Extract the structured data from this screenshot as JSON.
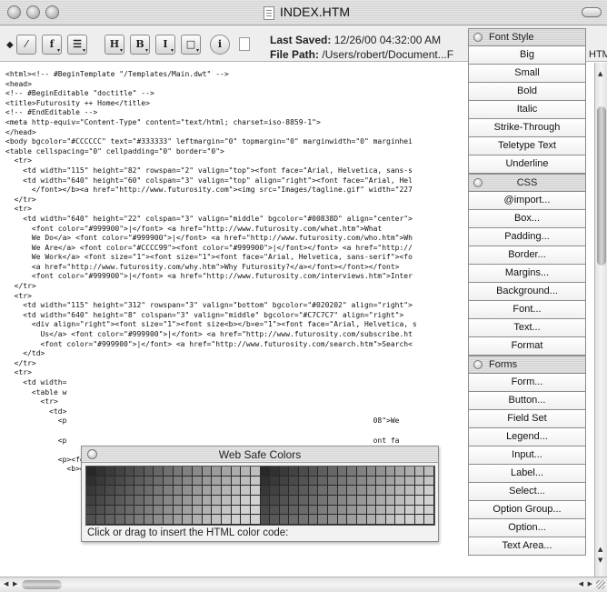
{
  "window": {
    "title": "INDEX.HTM"
  },
  "toolbar": {
    "buttons": [
      {
        "glyph": "⁄"
      },
      {
        "glyph": "f"
      },
      {
        "glyph": "☰"
      },
      {
        "glyph": "H"
      },
      {
        "glyph": "B"
      },
      {
        "glyph": "I"
      },
      {
        "glyph": "□"
      },
      {
        "glyph": "i"
      }
    ],
    "last_saved_label": "Last Saved:",
    "last_saved_value": "12/26/00 04:32:00 AM",
    "file_path_label": "File Path:",
    "file_path_value": "/Users/robert/Document...F",
    "right_text": "HTM"
  },
  "code_lines": [
    "<html><!-- #BeginTemplate \"/Templates/Main.dwt\" -->",
    "<head>",
    "<!-- #BeginEditable \"doctitle\" -->",
    "<title>Futurosity ++ Home</title>",
    "<!-- #EndEditable -->",
    "<meta http-equiv=\"Content-Type\" content=\"text/html; charset=iso-8859-1\">",
    "</head>",
    "<body bgcolor=\"#CCCCCC\" text=\"#333333\" leftmargin=\"0\" topmargin=\"0\" marginwidth=\"0\" marginhei",
    "<table cellspacing=\"0\" cellpadding=\"0\" border=\"0\">",
    "  <tr>",
    "    <td width=\"115\" height=\"82\" rowspan=\"2\" valign=\"top\"><font face=\"Arial, Helvetica, sans-s",
    "    <td width=\"640\" height=\"60\" colspan=\"3\" valign=\"top\" align=\"right\"><font face=\"Arial, Hel",
    "      </font></b><a href=\"http://www.futurosity.com\"><img src=\"Images/tagline.gif\" width=\"227",
    "  </tr>",
    "  <tr>",
    "    <td width=\"640\" height=\"22\" colspan=\"3\" valign=\"middle\" bgcolor=\"#00838D\" align=\"center\">",
    "      <font color=\"#999900\">|</font> <a href=\"http://www.futurosity.com/what.htm\">What",
    "      We Do</a> <font color=\"#999900\">|</font> <a href=\"http://www.futurosity.com/who.htm\">Wh",
    "      We Are</a> <font color=\"#CCCC99\"><font color=\"#999900\">|</font></font> <a href=\"http://",
    "      We Work</a> <font size=\"1\"><font size=\"1\"><font face=\"Arial, Helvetica, sans-serif\"><fo",
    "      <a href=\"http://www.futurosity.com/why.htm\">Why Futurosity?</a></font></font></font>",
    "      <font color=\"#999900\">|</font> <a href=\"http://www.futurosity.com/interviews.htm\">Inter",
    "  </tr>",
    "  <tr>",
    "    <td width=\"115\" height=\"312\" rowspan=\"3\" valign=\"bottom\" bgcolor=\"#020202\" align=\"right\">",
    "    <td width=\"640\" height=\"8\" colspan=\"3\" valign=\"middle\" bgcolor=\"#C7C7C7\" align=\"right\">",
    "      <div align=\"right\"><font size=\"1\"><font size<b></b=e=\"1\"><font face=\"Arial, Helvetica, s",
    "        Us</a> <font color=\"#999900\">|</font> <a href=\"http://www.futurosity.com/subscribe.ht",
    "        <font color=\"#999900\">|</font> <a href=\"http://www.futurosity.com/search.htm\">Search<",
    "    </td>",
    "  </tr>",
    "  <tr>",
    "    <td width=",
    "      <table w",
    "        <tr>",
    "          <td>",
    "            <p                                                                      08\">We",
    "",
    "            <p                                                                      ont fa",
    "",
    "            <p><font face=\"Arial, Helvetica, sans-serif\" size=\"2\">We work with",
    "              <b>entrepreneurs</b> to turn inspiration into implementation. We'll"
  ],
  "palette": {
    "sections": [
      {
        "title": "Font Style",
        "items": [
          "Big",
          "Small",
          "Bold",
          "Italic",
          "Strike-Through",
          "Teletype Text",
          "Underline"
        ]
      },
      {
        "title": "CSS",
        "items": [
          "@import...",
          "Box...",
          "Padding...",
          "Border...",
          "Margins...",
          "Background...",
          "Font...",
          "Text...",
          "Format"
        ]
      },
      {
        "title": "Forms",
        "items": [
          "Form...",
          "Button...",
          "Field Set",
          "Legend...",
          "Input...",
          "Label...",
          "Select...",
          "Option Group...",
          "Option...",
          "Text Area..."
        ]
      }
    ]
  },
  "web_safe_colors": {
    "title": "Web Safe Colors",
    "hint": "Click or drag to insert the HTML color code:"
  }
}
